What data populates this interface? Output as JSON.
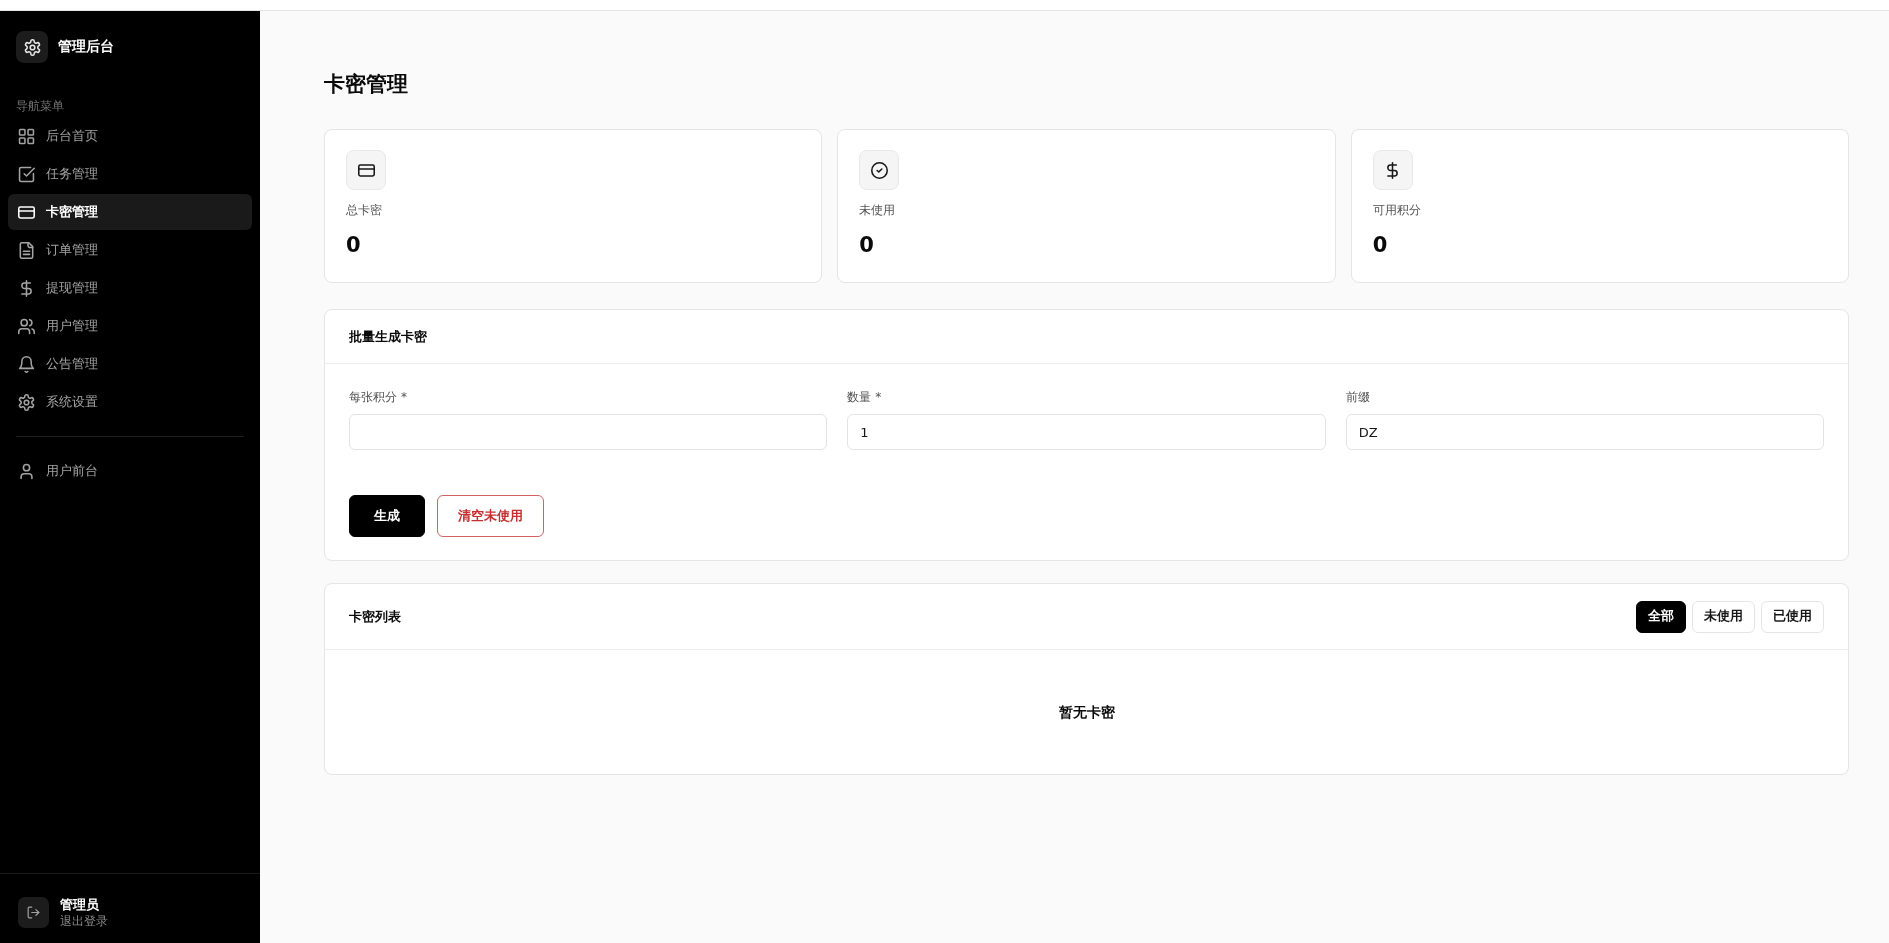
{
  "sidebar": {
    "brand": {
      "title": "管理后台"
    },
    "section_label": "导航菜单",
    "items": [
      {
        "label": "后台首页",
        "selected": false
      },
      {
        "label": "任务管理",
        "selected": false
      },
      {
        "label": "卡密管理",
        "selected": true
      },
      {
        "label": "订单管理",
        "selected": false
      },
      {
        "label": "提现管理",
        "selected": false
      },
      {
        "label": "用户管理",
        "selected": false
      },
      {
        "label": "公告管理",
        "selected": false
      },
      {
        "label": "系统设置",
        "selected": false
      }
    ],
    "secondary_items": [
      {
        "label": "用户前台",
        "selected": false
      }
    ],
    "user": {
      "name": "管理员",
      "action": "退出登录"
    }
  },
  "page": {
    "title": "卡密管理"
  },
  "stats": [
    {
      "label": "总卡密",
      "value": "0"
    },
    {
      "label": "未使用",
      "value": "0"
    },
    {
      "label": "可用积分",
      "value": "0"
    }
  ],
  "generate_form": {
    "title": "批量生成卡密",
    "fields": [
      {
        "label": "每张积分",
        "required_mark": "*"
      },
      {
        "label": "数量",
        "required_mark": "*",
        "value": "1"
      },
      {
        "label": "前缀",
        "value": "DZ"
      }
    ],
    "buttons": [
      {
        "label": "生成",
        "kind": "primary"
      },
      {
        "label": "清空未使用",
        "kind": "danger"
      }
    ]
  },
  "card_list": {
    "title": "卡密列表",
    "filters": [
      {
        "label": "全部",
        "selected": true
      },
      {
        "label": "未使用",
        "selected": false
      },
      {
        "label": "已使用",
        "selected": false
      }
    ],
    "empty_message": "暂无卡密"
  }
}
